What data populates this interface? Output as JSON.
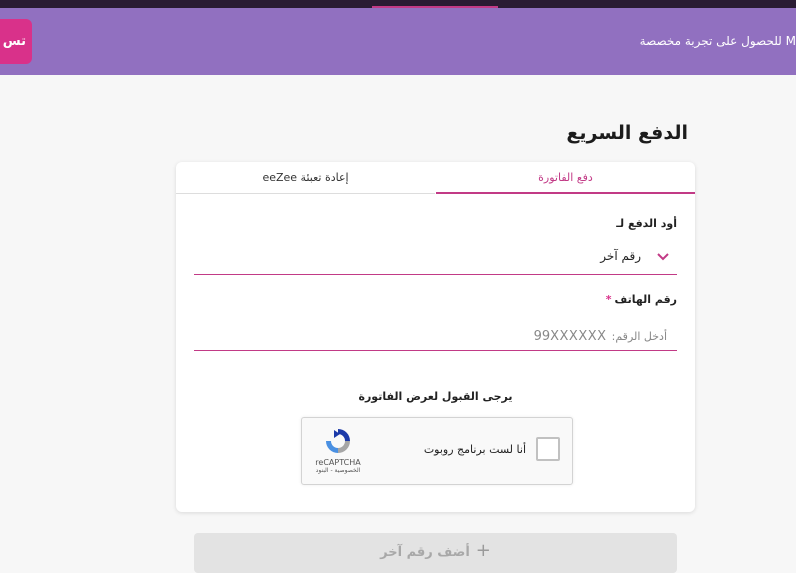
{
  "banner": {
    "text": "للحصول على تجربة مخصصة M",
    "button_label": "تس"
  },
  "page": {
    "title": "الدفع السريع"
  },
  "tabs": [
    {
      "label": "دفع الفاتورة",
      "active": true
    },
    {
      "label": "إعادة تعبئة eeZee",
      "active": false
    }
  ],
  "form": {
    "pay_for_label": "أود الدفع لـ",
    "pay_for_value": "رقم آخر",
    "phone_label": "رقم الهاتف",
    "phone_required_mark": "*",
    "phone_placeholder_label": "أدخل الرقم:",
    "phone_placeholder_example": "99XXXXXX",
    "accept_text": "يرجى القبول لعرض الفاتورة"
  },
  "recaptcha": {
    "label": "أنا لست برنامج روبوت",
    "brand": "reCAPTCHA",
    "links": "الخصوصية - البنود"
  },
  "actions": {
    "add_number_label": "أضف رقم آخر"
  },
  "colors": {
    "banner": "#9170c0",
    "accent": "#c23a86",
    "button": "#d9318a"
  }
}
